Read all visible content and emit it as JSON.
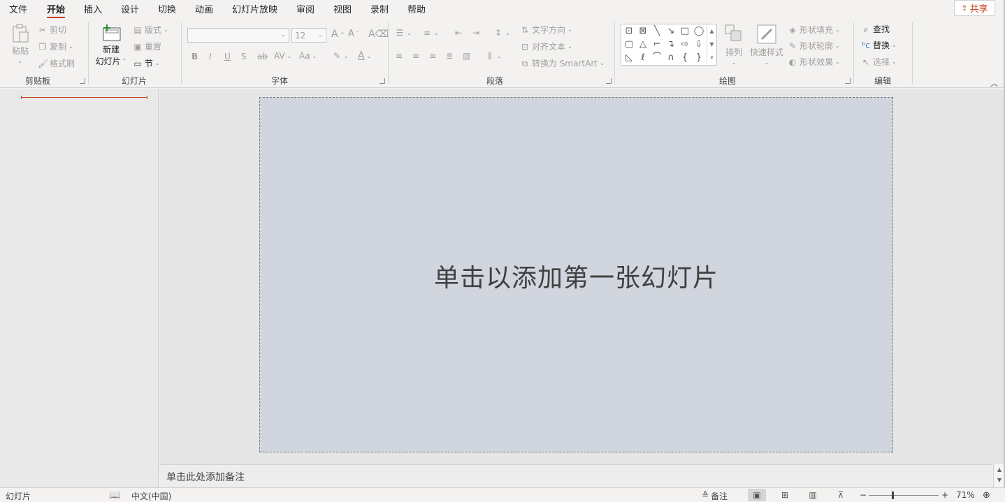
{
  "menu": {
    "tabs": [
      "文件",
      "开始",
      "插入",
      "设计",
      "切换",
      "动画",
      "幻灯片放映",
      "审阅",
      "视图",
      "录制",
      "帮助"
    ],
    "active_tab": "开始",
    "share_label": "共享"
  },
  "ribbon": {
    "clipboard": {
      "label": "剪贴板",
      "paste": "粘贴",
      "cut": "剪切",
      "copy": "复制",
      "format_painter": "格式刷"
    },
    "slides": {
      "label": "幻灯片",
      "new_slide_line1": "新建",
      "new_slide_line2": "幻灯片",
      "layout": "版式",
      "reset": "重置",
      "section": "节"
    },
    "font": {
      "label": "字体",
      "font_name": "",
      "font_size": "12",
      "bold": "B",
      "italic": "I",
      "underline": "U",
      "shadow": "S",
      "strike": "ab",
      "char_spacing": "AV",
      "change_case": "Aa",
      "font_color": "A"
    },
    "paragraph": {
      "label": "段落",
      "text_direction": "文字方向",
      "align_text": "对齐文本",
      "convert_smartart": "转换为 SmartArt"
    },
    "drawing": {
      "label": "绘图",
      "arrange": "排列",
      "quick_styles": "快速样式",
      "shape_fill": "形状填充",
      "shape_outline": "形状轮廓",
      "shape_effects": "形状效果"
    },
    "editing": {
      "label": "编辑",
      "find": "查找",
      "replace": "替换",
      "select": "选择"
    }
  },
  "slide": {
    "placeholder": "单击以添加第一张幻灯片"
  },
  "notes": {
    "placeholder": "单击此处添加备注"
  },
  "status_bar": {
    "slide_label": "幻灯片",
    "language": "中文(中国)",
    "notes_label": "备注",
    "zoom": "71%",
    "zoom_level_percent": 71
  },
  "colors": {
    "accent": "#c43e1c",
    "slide_bg": "#d1d5de",
    "ribbon_bg": "#f3f2f1"
  }
}
